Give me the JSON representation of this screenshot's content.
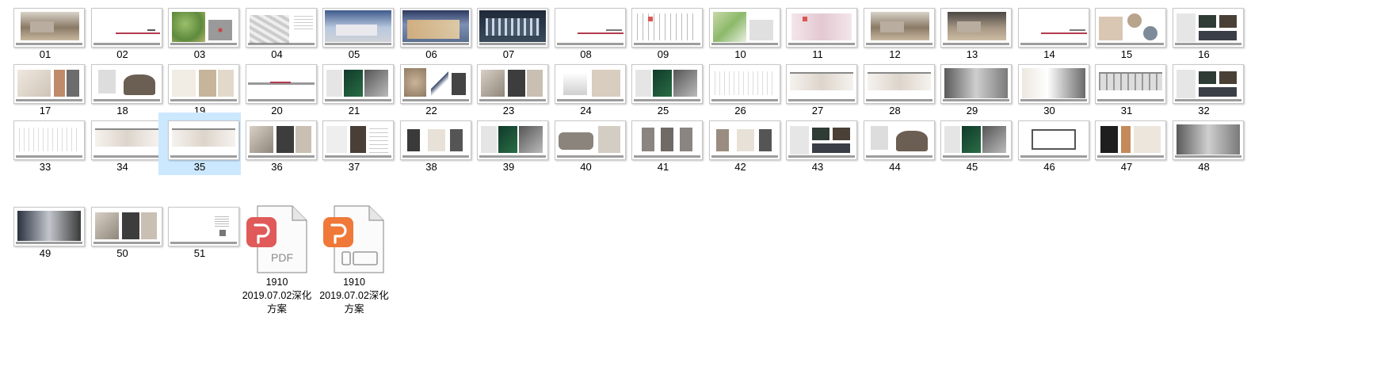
{
  "folder": {
    "selected_item": "35",
    "thumbnails": [
      {
        "name": "01",
        "style": "interior-warm"
      },
      {
        "name": "02",
        "style": "blank-redline"
      },
      {
        "name": "03",
        "style": "site-plan-green"
      },
      {
        "name": "04",
        "style": "masterplan-grey"
      },
      {
        "name": "05",
        "style": "building-dusk"
      },
      {
        "name": "06",
        "style": "building-dusk-dark"
      },
      {
        "name": "07",
        "style": "facade-night"
      },
      {
        "name": "08",
        "style": "blank-redline-right"
      },
      {
        "name": "09",
        "style": "floorplan"
      },
      {
        "name": "10",
        "style": "site-plan-green-light"
      },
      {
        "name": "11",
        "style": "floorplan-pink"
      },
      {
        "name": "12",
        "style": "interior-warm"
      },
      {
        "name": "13",
        "style": "interior-warm-dark"
      },
      {
        "name": "14",
        "style": "blank-redline-right"
      },
      {
        "name": "15",
        "style": "moodboard-circles"
      },
      {
        "name": "16",
        "style": "moodboard-dark"
      },
      {
        "name": "17",
        "style": "material-bath"
      },
      {
        "name": "18",
        "style": "furniture"
      },
      {
        "name": "19",
        "style": "material-swatch"
      },
      {
        "name": "20",
        "style": "blank-redline-full"
      },
      {
        "name": "21",
        "style": "green-collage"
      },
      {
        "name": "22",
        "style": "sculpture"
      },
      {
        "name": "23",
        "style": "material-collage"
      },
      {
        "name": "24",
        "style": "product-white"
      },
      {
        "name": "25",
        "style": "green-collage"
      },
      {
        "name": "26",
        "style": "floorplan-light"
      },
      {
        "name": "27",
        "style": "elevation"
      },
      {
        "name": "28",
        "style": "elevation"
      },
      {
        "name": "29",
        "style": "interior-render-grey"
      },
      {
        "name": "30",
        "style": "interior-render-light"
      },
      {
        "name": "31",
        "style": "elevation-dark"
      },
      {
        "name": "32",
        "style": "moodboard-dark"
      },
      {
        "name": "33",
        "style": "floorplan-light"
      },
      {
        "name": "34",
        "style": "elevation"
      },
      {
        "name": "35",
        "style": "elevation"
      },
      {
        "name": "36",
        "style": "material-collage"
      },
      {
        "name": "37",
        "style": "furniture-grid"
      },
      {
        "name": "38",
        "style": "chairs"
      },
      {
        "name": "39",
        "style": "green-collage"
      },
      {
        "name": "40",
        "style": "sofa"
      },
      {
        "name": "41",
        "style": "panels-grey"
      },
      {
        "name": "42",
        "style": "chairs-light"
      },
      {
        "name": "43",
        "style": "moodboard-dark"
      },
      {
        "name": "44",
        "style": "furniture"
      },
      {
        "name": "45",
        "style": "green-collage"
      },
      {
        "name": "46",
        "style": "floorplan-box"
      },
      {
        "name": "47",
        "style": "lamp-collage"
      },
      {
        "name": "48",
        "style": "interior-render-grey"
      },
      {
        "name": "49",
        "style": "interior-render-dark"
      },
      {
        "name": "50",
        "style": "material-collage"
      },
      {
        "name": "51",
        "style": "blank-text"
      }
    ],
    "files": [
      {
        "line1": "1910",
        "line2": "2019.07.02深化",
        "line3": "方案",
        "type": "pdf",
        "icon": "wps-pdf-icon",
        "accent": "#e05a5a",
        "badge_text": "PDF"
      },
      {
        "line1": "1910",
        "line2": "2019.07.02深化",
        "line3": "方案",
        "type": "ppt",
        "icon": "wps-presentation-icon",
        "accent": "#f07838",
        "badge_text": ""
      }
    ],
    "colors": {
      "selection": "#cce8ff",
      "redline": "#b33a4d",
      "pdf": "#e05a5a",
      "ppt": "#f07838"
    }
  }
}
